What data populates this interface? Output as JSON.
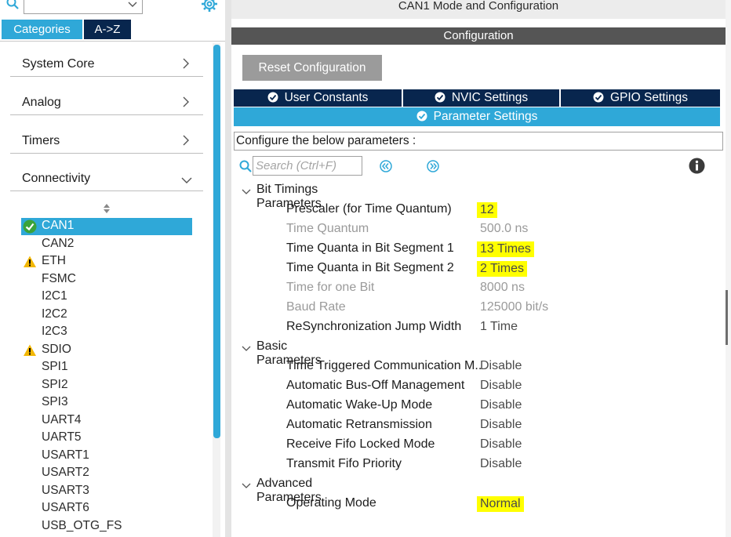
{
  "left_panel": {
    "tabs": {
      "categories": "Categories",
      "az": "A->Z"
    },
    "categories": [
      {
        "label": "System Core",
        "chevron": "chevron-right"
      },
      {
        "label": "Analog",
        "chevron": "chevron-right"
      },
      {
        "label": "Timers",
        "chevron": "chevron-right"
      },
      {
        "label": "Connectivity",
        "chevron": "chevron-down"
      }
    ],
    "peripherals": [
      {
        "label": "CAN1",
        "status": "ok",
        "selected": true
      },
      {
        "label": "CAN2"
      },
      {
        "label": "ETH",
        "status": "warning"
      },
      {
        "label": "FSMC"
      },
      {
        "label": "I2C1"
      },
      {
        "label": "I2C2"
      },
      {
        "label": "I2C3"
      },
      {
        "label": "SDIO",
        "status": "warning"
      },
      {
        "label": "SPI1"
      },
      {
        "label": "SPI2"
      },
      {
        "label": "SPI3"
      },
      {
        "label": "UART4"
      },
      {
        "label": "UART5"
      },
      {
        "label": "USART1"
      },
      {
        "label": "USART2"
      },
      {
        "label": "USART3"
      },
      {
        "label": "USART6"
      },
      {
        "label": "USB_OTG_FS"
      }
    ]
  },
  "right_panel": {
    "mode_title": "CAN1 Mode and Configuration",
    "config_bar": "Configuration",
    "reset_button": "Reset Configuration",
    "tabs": {
      "user_constants": "User Constants",
      "nvic": "NVIC Settings",
      "gpio": "GPIO Settings",
      "parameter": "Parameter Settings"
    },
    "configure_text": "Configure the below parameters :",
    "search_placeholder": "Search (Ctrl+F)",
    "groups": {
      "bit_timings": {
        "label": "Bit Timings Parameters",
        "rows": [
          {
            "name": "Prescaler (for Time Quantum)",
            "value": "12"
          },
          {
            "name": "Time Quantum",
            "value": "500.0 ns"
          },
          {
            "name": "Time Quanta in Bit Segment 1",
            "value": "13 Times"
          },
          {
            "name": "Time Quanta in Bit Segment 2",
            "value": "2 Times"
          },
          {
            "name": "Time for one Bit",
            "value": "8000 ns"
          },
          {
            "name": "Baud Rate",
            "value": "125000 bit/s"
          },
          {
            "name": "ReSynchronization Jump Width",
            "value": "1 Time"
          }
        ]
      },
      "basic": {
        "label": "Basic Parameters",
        "rows": [
          {
            "name": "Time Triggered Communication M..",
            "value": "Disable"
          },
          {
            "name": "Automatic Bus-Off Management",
            "value": "Disable"
          },
          {
            "name": "Automatic Wake-Up Mode",
            "value": "Disable"
          },
          {
            "name": "Automatic Retransmission",
            "value": "Disable"
          },
          {
            "name": "Receive Fifo Locked Mode",
            "value": "Disable"
          },
          {
            "name": "Transmit Fifo Priority",
            "value": "Disable"
          }
        ]
      },
      "advanced": {
        "label": "Advanced Parameters",
        "rows": [
          {
            "name": "Operating Mode",
            "value": "Normal"
          }
        ]
      }
    }
  },
  "colors": {
    "accent_blue": "#2fa8d8",
    "navy": "#08264e",
    "config_bar": "#555555",
    "highlight": "#ffff00",
    "warning": "#f2b705",
    "ok_green": "#3aa33a"
  }
}
